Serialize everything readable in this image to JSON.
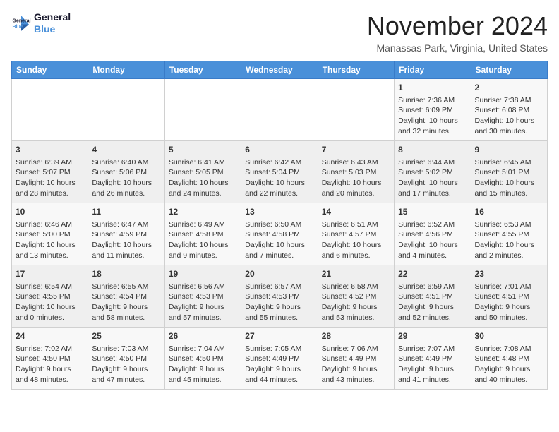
{
  "logo": {
    "line1": "General",
    "line2": "Blue"
  },
  "title": "November 2024",
  "location": "Manassas Park, Virginia, United States",
  "weekdays": [
    "Sunday",
    "Monday",
    "Tuesday",
    "Wednesday",
    "Thursday",
    "Friday",
    "Saturday"
  ],
  "weeks": [
    [
      {
        "day": "",
        "info": ""
      },
      {
        "day": "",
        "info": ""
      },
      {
        "day": "",
        "info": ""
      },
      {
        "day": "",
        "info": ""
      },
      {
        "day": "",
        "info": ""
      },
      {
        "day": "1",
        "info": "Sunrise: 7:36 AM\nSunset: 6:09 PM\nDaylight: 10 hours and 32 minutes."
      },
      {
        "day": "2",
        "info": "Sunrise: 7:38 AM\nSunset: 6:08 PM\nDaylight: 10 hours and 30 minutes."
      }
    ],
    [
      {
        "day": "3",
        "info": "Sunrise: 6:39 AM\nSunset: 5:07 PM\nDaylight: 10 hours and 28 minutes."
      },
      {
        "day": "4",
        "info": "Sunrise: 6:40 AM\nSunset: 5:06 PM\nDaylight: 10 hours and 26 minutes."
      },
      {
        "day": "5",
        "info": "Sunrise: 6:41 AM\nSunset: 5:05 PM\nDaylight: 10 hours and 24 minutes."
      },
      {
        "day": "6",
        "info": "Sunrise: 6:42 AM\nSunset: 5:04 PM\nDaylight: 10 hours and 22 minutes."
      },
      {
        "day": "7",
        "info": "Sunrise: 6:43 AM\nSunset: 5:03 PM\nDaylight: 10 hours and 20 minutes."
      },
      {
        "day": "8",
        "info": "Sunrise: 6:44 AM\nSunset: 5:02 PM\nDaylight: 10 hours and 17 minutes."
      },
      {
        "day": "9",
        "info": "Sunrise: 6:45 AM\nSunset: 5:01 PM\nDaylight: 10 hours and 15 minutes."
      }
    ],
    [
      {
        "day": "10",
        "info": "Sunrise: 6:46 AM\nSunset: 5:00 PM\nDaylight: 10 hours and 13 minutes."
      },
      {
        "day": "11",
        "info": "Sunrise: 6:47 AM\nSunset: 4:59 PM\nDaylight: 10 hours and 11 minutes."
      },
      {
        "day": "12",
        "info": "Sunrise: 6:49 AM\nSunset: 4:58 PM\nDaylight: 10 hours and 9 minutes."
      },
      {
        "day": "13",
        "info": "Sunrise: 6:50 AM\nSunset: 4:58 PM\nDaylight: 10 hours and 7 minutes."
      },
      {
        "day": "14",
        "info": "Sunrise: 6:51 AM\nSunset: 4:57 PM\nDaylight: 10 hours and 6 minutes."
      },
      {
        "day": "15",
        "info": "Sunrise: 6:52 AM\nSunset: 4:56 PM\nDaylight: 10 hours and 4 minutes."
      },
      {
        "day": "16",
        "info": "Sunrise: 6:53 AM\nSunset: 4:55 PM\nDaylight: 10 hours and 2 minutes."
      }
    ],
    [
      {
        "day": "17",
        "info": "Sunrise: 6:54 AM\nSunset: 4:55 PM\nDaylight: 10 hours and 0 minutes."
      },
      {
        "day": "18",
        "info": "Sunrise: 6:55 AM\nSunset: 4:54 PM\nDaylight: 9 hours and 58 minutes."
      },
      {
        "day": "19",
        "info": "Sunrise: 6:56 AM\nSunset: 4:53 PM\nDaylight: 9 hours and 57 minutes."
      },
      {
        "day": "20",
        "info": "Sunrise: 6:57 AM\nSunset: 4:53 PM\nDaylight: 9 hours and 55 minutes."
      },
      {
        "day": "21",
        "info": "Sunrise: 6:58 AM\nSunset: 4:52 PM\nDaylight: 9 hours and 53 minutes."
      },
      {
        "day": "22",
        "info": "Sunrise: 6:59 AM\nSunset: 4:51 PM\nDaylight: 9 hours and 52 minutes."
      },
      {
        "day": "23",
        "info": "Sunrise: 7:01 AM\nSunset: 4:51 PM\nDaylight: 9 hours and 50 minutes."
      }
    ],
    [
      {
        "day": "24",
        "info": "Sunrise: 7:02 AM\nSunset: 4:50 PM\nDaylight: 9 hours and 48 minutes."
      },
      {
        "day": "25",
        "info": "Sunrise: 7:03 AM\nSunset: 4:50 PM\nDaylight: 9 hours and 47 minutes."
      },
      {
        "day": "26",
        "info": "Sunrise: 7:04 AM\nSunset: 4:50 PM\nDaylight: 9 hours and 45 minutes."
      },
      {
        "day": "27",
        "info": "Sunrise: 7:05 AM\nSunset: 4:49 PM\nDaylight: 9 hours and 44 minutes."
      },
      {
        "day": "28",
        "info": "Sunrise: 7:06 AM\nSunset: 4:49 PM\nDaylight: 9 hours and 43 minutes."
      },
      {
        "day": "29",
        "info": "Sunrise: 7:07 AM\nSunset: 4:49 PM\nDaylight: 9 hours and 41 minutes."
      },
      {
        "day": "30",
        "info": "Sunrise: 7:08 AM\nSunset: 4:48 PM\nDaylight: 9 hours and 40 minutes."
      }
    ]
  ]
}
